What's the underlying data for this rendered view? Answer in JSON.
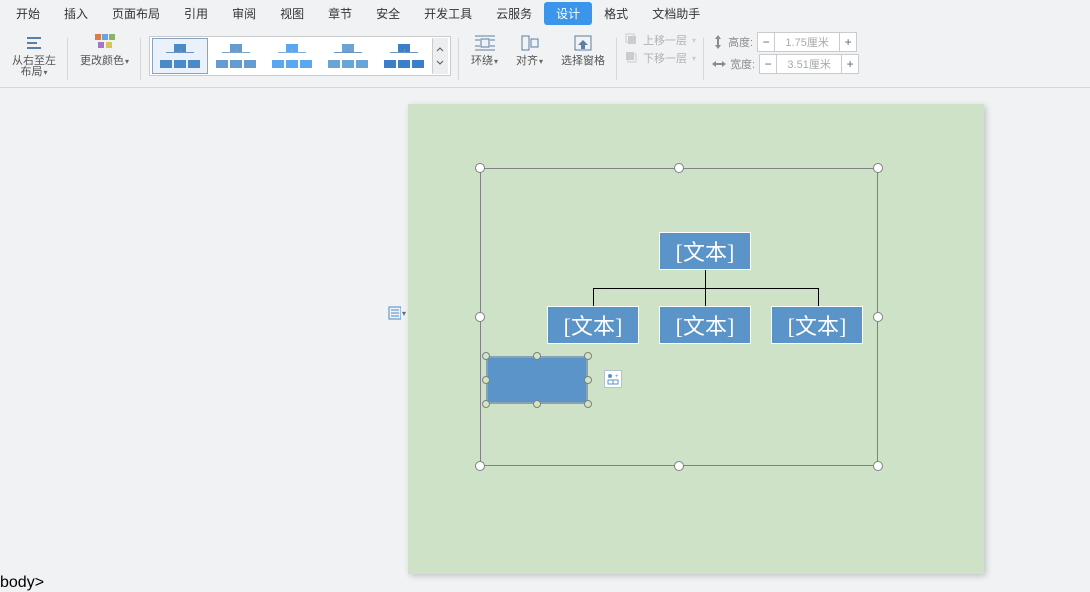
{
  "menu": {
    "items": [
      "开始",
      "插入",
      "页面布局",
      "引用",
      "审阅",
      "视图",
      "章节",
      "安全",
      "开发工具",
      "云服务",
      "设计",
      "格式",
      "文档助手"
    ],
    "active_index": 10
  },
  "ribbon": {
    "rtl_label": "从右至左",
    "layout_label": "布局",
    "colors_label": "更改颜色",
    "wrap_label": "环绕",
    "align_label": "对齐",
    "pane_label": "选择窗格",
    "bring_fwd": "上移一层",
    "send_back": "下移一层",
    "height_label": "高度:",
    "width_label": "宽度:",
    "height_value": "1.75厘米",
    "width_value": "3.51厘米",
    "minus": "−",
    "plus": "+"
  },
  "smartart": {
    "text_placeholder": "[文本]"
  },
  "floaticon_glyph": "⊞"
}
